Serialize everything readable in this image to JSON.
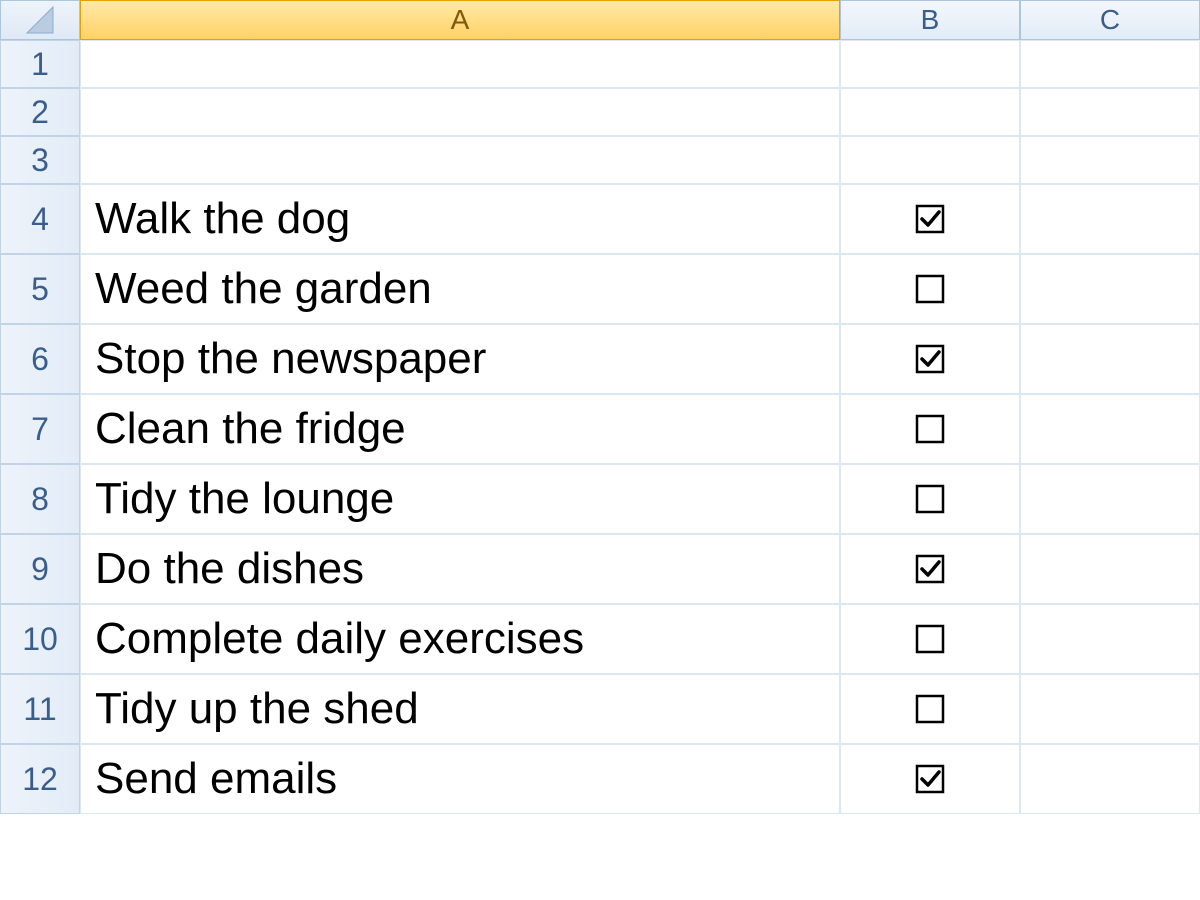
{
  "columns": [
    "A",
    "B",
    "C"
  ],
  "smallRows": [
    1,
    2,
    3
  ],
  "tasks": [
    {
      "row": 4,
      "text": "Walk the dog",
      "checked": true
    },
    {
      "row": 5,
      "text": "Weed the garden",
      "checked": false
    },
    {
      "row": 6,
      "text": "Stop the newspaper",
      "checked": true
    },
    {
      "row": 7,
      "text": "Clean the fridge",
      "checked": false
    },
    {
      "row": 8,
      "text": "Tidy the lounge",
      "checked": false
    },
    {
      "row": 9,
      "text": "Do the dishes",
      "checked": true
    },
    {
      "row": 10,
      "text": "Complete daily exercises",
      "checked": false
    },
    {
      "row": 11,
      "text": "Tidy up the shed",
      "checked": false
    },
    {
      "row": 12,
      "text": "Send emails",
      "checked": true
    }
  ],
  "selectedColumnIndex": 0
}
